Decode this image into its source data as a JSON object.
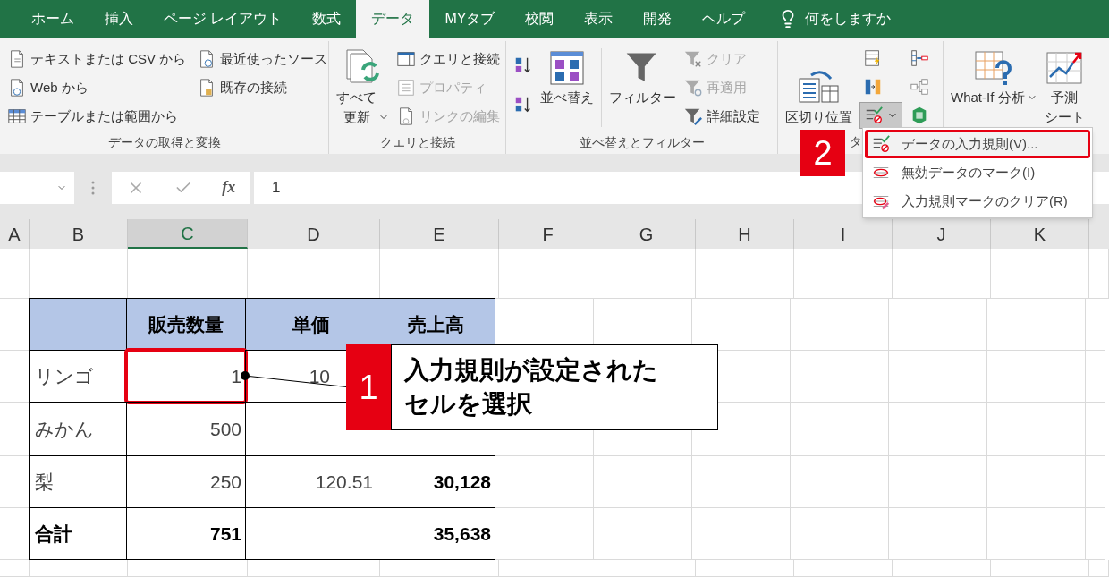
{
  "tabs": [
    {
      "label": "ホーム",
      "selected": false
    },
    {
      "label": "挿入",
      "selected": false
    },
    {
      "label": "ページ レイアウト",
      "selected": false
    },
    {
      "label": "数式",
      "selected": false
    },
    {
      "label": "データ",
      "selected": true
    },
    {
      "label": "MYタブ",
      "selected": false
    },
    {
      "label": "校閲",
      "selected": false
    },
    {
      "label": "表示",
      "selected": false
    },
    {
      "label": "開発",
      "selected": false
    },
    {
      "label": "ヘルプ",
      "selected": false
    }
  ],
  "tell_me": {
    "label": "何をしますか"
  },
  "ribbon": {
    "groups": [
      {
        "label": "データの取得と変換",
        "buttons": [
          {
            "label": "テキストまたは CSV から",
            "kind": "text-file",
            "disabled": false
          },
          {
            "label": "Web から",
            "kind": "web",
            "disabled": false
          },
          {
            "label": "テーブルまたは範囲から",
            "kind": "table",
            "disabled": false
          },
          {
            "label": "最近使ったソース",
            "kind": "recent",
            "disabled": false
          },
          {
            "label": "既存の接続",
            "kind": "existing",
            "disabled": false
          }
        ]
      },
      {
        "label": "クエリと接続",
        "buttons": [
          {
            "label_lines": [
              "すべて",
              "更新"
            ],
            "kind": "refresh",
            "disabled": false
          },
          {
            "label": "クエリと接続",
            "kind": "queries",
            "disabled": false
          },
          {
            "label": "プロパティ",
            "kind": "properties",
            "disabled": true
          },
          {
            "label": "リンクの編集",
            "kind": "links",
            "disabled": true
          }
        ]
      },
      {
        "label": "並べ替えとフィルター",
        "buttons": [
          {
            "kind": "sort-asc",
            "disabled": false
          },
          {
            "kind": "sort-desc",
            "disabled": false
          },
          {
            "label": "並べ替え",
            "kind": "sort",
            "disabled": false
          },
          {
            "label": "フィルター",
            "kind": "filter",
            "disabled": false
          },
          {
            "label": "クリア",
            "kind": "clear",
            "disabled": true
          },
          {
            "label": "再適用",
            "kind": "reapply",
            "disabled": true
          },
          {
            "label": "詳細設定",
            "kind": "advanced",
            "disabled": false
          }
        ]
      },
      {
        "label": "タ",
        "buttons": [
          {
            "label": "区切り位置",
            "kind": "columns",
            "disabled": false
          },
          {
            "kind": "flash-fill",
            "disabled": false
          },
          {
            "kind": "remove-duplicates",
            "disabled": false
          },
          {
            "kind": "validation",
            "disabled": false,
            "expanded": true
          },
          {
            "kind": "consolidate",
            "disabled": false
          },
          {
            "kind": "relationships",
            "disabled": false
          },
          {
            "kind": "data-model",
            "disabled": false
          }
        ]
      },
      {
        "buttons": [
          {
            "label": "What-If 分析",
            "kind": "what-if",
            "disabled": false
          },
          {
            "label_lines": [
              "予測",
              "シート"
            ],
            "kind": "forecast",
            "disabled": false
          }
        ]
      }
    ]
  },
  "formula_bar": {
    "function_label": "fx",
    "value": "1"
  },
  "columns": [
    {
      "label": "A",
      "selected": false
    },
    {
      "label": "B",
      "selected": false
    },
    {
      "label": "C",
      "selected": true
    },
    {
      "label": "D",
      "selected": false
    },
    {
      "label": "E",
      "selected": false
    },
    {
      "label": "F",
      "selected": false
    },
    {
      "label": "G",
      "selected": false
    },
    {
      "label": "H",
      "selected": false
    },
    {
      "label": "I",
      "selected": false
    },
    {
      "label": "J",
      "selected": false
    },
    {
      "label": "K",
      "selected": false
    }
  ],
  "table": {
    "header": [
      "販売数量",
      "単価",
      "売上高"
    ],
    "rows": [
      {
        "kind": "data",
        "cells": [
          {
            "text": "リンゴ",
            "selected": false
          },
          {
            "text": "1",
            "selected": true
          },
          {
            "text": "10",
            "selected": false
          }
        ]
      },
      {
        "kind": "data",
        "cells": [
          {
            "text": "みかん",
            "selected": false
          },
          {
            "text": "500",
            "selected": false
          },
          {
            "selected": false
          },
          {
            "selected": false
          }
        ]
      },
      {
        "kind": "data",
        "cells": [
          {
            "text": "梨",
            "selected": false
          },
          {
            "text": "250",
            "selected": false
          },
          {
            "text": "120.51",
            "selected": false
          },
          {
            "text": "30,128",
            "selected": false
          }
        ]
      },
      {
        "kind": "total",
        "cells": [
          {
            "text": "合計",
            "selected": false
          },
          {
            "text": "751",
            "selected": false
          },
          {
            "selected": false
          },
          {
            "text": "35,638",
            "selected": false
          }
        ]
      }
    ]
  },
  "menu": {
    "items": [
      {
        "label": "データの入力規則(V)...",
        "kind": "validation",
        "selected": true
      },
      {
        "label": "無効データのマーク(I)",
        "kind": "circle",
        "selected": false
      },
      {
        "label": "入力規則マークのクリア(R)",
        "kind": "clear-circles",
        "selected": false
      }
    ]
  },
  "callouts": [
    {
      "number": "1",
      "lines": [
        "入力規則が設定された",
        "セルを選択"
      ]
    },
    {
      "number": "2"
    }
  ]
}
